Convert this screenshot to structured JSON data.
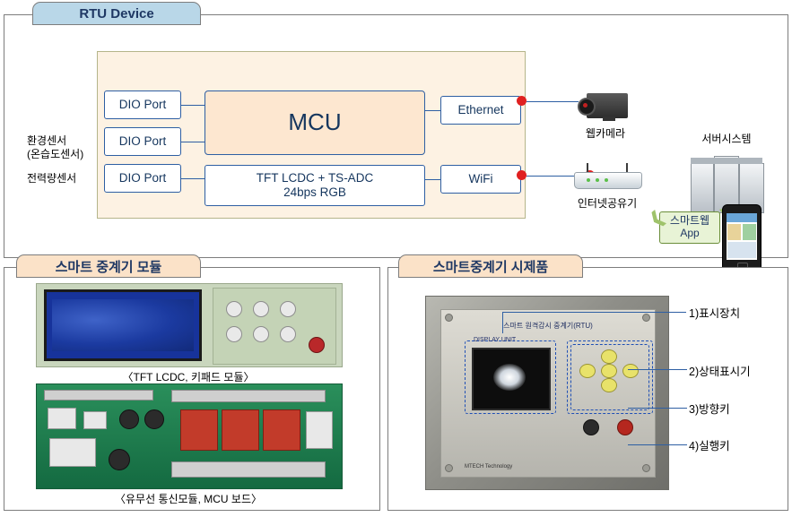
{
  "panels": {
    "rtu": {
      "title": "RTU Device"
    },
    "module": {
      "title": "스마트 중계기 모듈"
    },
    "prototype": {
      "title": "스마트중계기 시제품"
    }
  },
  "rtu": {
    "ports": [
      {
        "label": "DIO Port"
      },
      {
        "label": "DIO Port"
      },
      {
        "label": "DIO Port"
      }
    ],
    "mcu": "MCU",
    "display_ctrl": "TFT LCDC + TS-ADC\n24bps RGB",
    "display_ctrl_line1": "TFT LCDC + TS-ADC",
    "display_ctrl_line2": "24bps RGB",
    "ethernet": "Ethernet",
    "wifi": "WiFi",
    "sensor_env_line1": "환경센서",
    "sensor_env_line2": "(온습도센서)",
    "sensor_power": "전력량센서",
    "webcam_caption": "웹카메라",
    "router_caption": "인터넷공유기",
    "server_caption": "서버시스템",
    "smartweb_line1": "스마트웹",
    "smartweb_line2": "App"
  },
  "module": {
    "caption_top": "〈TFT LCDC, 키패드 모듈〉",
    "caption_bottom": "〈유무선 통신모듈, MCU 보드〉"
  },
  "prototype": {
    "device_title": "스마트 원격감시 중계기(RTU)",
    "screen_label": "DISPLAY UNIT",
    "footer_text": "MTECH Technology",
    "callouts": [
      {
        "label": "1)표시장치"
      },
      {
        "label": "2)상태표시기"
      },
      {
        "label": "3)방향키"
      },
      {
        "label": "4)실행키"
      }
    ]
  },
  "colors": {
    "panel_title_blue": "#b9d7e8",
    "panel_title_orange": "#fbe2c8",
    "box_border": "#2e5fa3",
    "mcu_fill": "#fde7d0",
    "board_fill": "#fdf2e3",
    "dot_red": "#e02020"
  }
}
